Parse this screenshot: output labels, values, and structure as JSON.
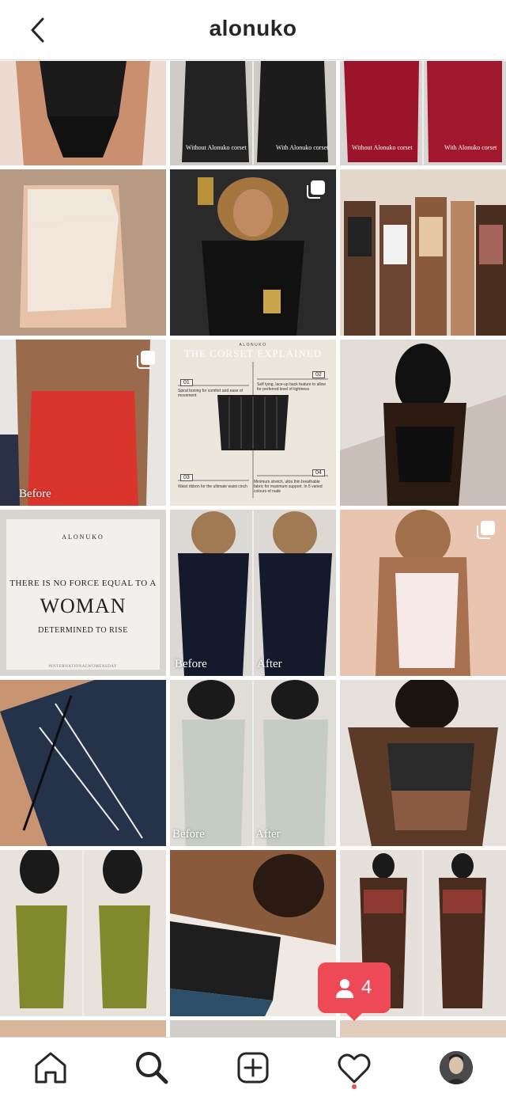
{
  "header": {
    "title": "alonuko",
    "back_icon": "chevron-left-icon"
  },
  "captions": {
    "without_corset": "Without Alonuko corset",
    "with_corset": "With Alonuko corset",
    "before": "Before",
    "after": "After"
  },
  "explained_card": {
    "brand": "ALONUKO",
    "title": "THE CORSET EXPLAINED",
    "points": [
      {
        "num": "01",
        "text": "Spiral boning for comfort and ease of movement"
      },
      {
        "num": "02",
        "text": "Self tying, lace-up back feature to allow for preferred level of tightness"
      },
      {
        "num": "03",
        "text": "Waist ribbon for the ultimate waist cinch"
      },
      {
        "num": "04",
        "text": "Minimum stretch, ultra thin breathable fabric for maximum support. In 5 varied colours of nude"
      }
    ]
  },
  "quote_card": {
    "brand": "ALONUKO",
    "line1": "THERE IS NO FORCE EQUAL TO A",
    "main": "WOMAN",
    "line3": "DETERMINED TO RISE",
    "tag": "#INTERNATIONALWOMENSDAY"
  },
  "notification": {
    "count": "4",
    "icon": "person-icon"
  },
  "nav": {
    "items": [
      "home-icon",
      "search-icon",
      "new-post-icon",
      "heart-icon",
      "profile-avatar"
    ],
    "active": "search"
  },
  "colors": {
    "accent": "#ed4956",
    "text": "#262626",
    "border": "#dbdbdb"
  }
}
